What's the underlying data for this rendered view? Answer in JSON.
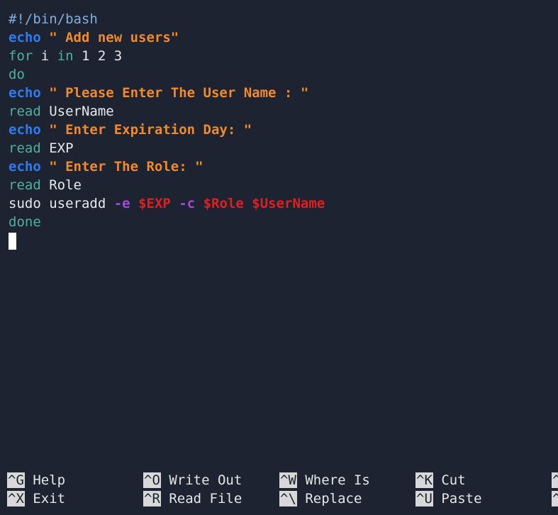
{
  "editor": {
    "lines": [
      [
        {
          "text": "#!/bin/bash",
          "style": "shebang"
        }
      ],
      [
        {
          "text": "echo",
          "style": "kw-bold"
        },
        {
          "text": " \" Add new users\"",
          "style": "str"
        }
      ],
      [
        {
          "text": "for",
          "style": "kw"
        },
        {
          "text": " i ",
          "style": "plain"
        },
        {
          "text": "in",
          "style": "kw"
        },
        {
          "text": " 1 2 3",
          "style": "plain"
        }
      ],
      [
        {
          "text": "do",
          "style": "kw"
        }
      ],
      [
        {
          "text": "echo",
          "style": "kw-bold"
        },
        {
          "text": " \" Please Enter The User Name : \"",
          "style": "str"
        }
      ],
      [
        {
          "text": "read",
          "style": "kw"
        },
        {
          "text": " UserName",
          "style": "plain"
        }
      ],
      [
        {
          "text": "echo",
          "style": "kw-bold"
        },
        {
          "text": " \" Enter Expiration Day: \"",
          "style": "str"
        }
      ],
      [
        {
          "text": "read",
          "style": "kw"
        },
        {
          "text": " EXP",
          "style": "plain"
        }
      ],
      [
        {
          "text": "echo",
          "style": "kw-bold"
        },
        {
          "text": " \" Enter The Role: \"",
          "style": "str"
        }
      ],
      [
        {
          "text": "read",
          "style": "kw"
        },
        {
          "text": " Role",
          "style": "plain"
        }
      ],
      [
        {
          "text": "sudo useradd ",
          "style": "plain"
        },
        {
          "text": "-e",
          "style": "flag"
        },
        {
          "text": " ",
          "style": "plain"
        },
        {
          "text": "$EXP",
          "style": "var"
        },
        {
          "text": " ",
          "style": "plain"
        },
        {
          "text": "-c",
          "style": "flag"
        },
        {
          "text": " ",
          "style": "plain"
        },
        {
          "text": "$Role",
          "style": "var"
        },
        {
          "text": " ",
          "style": "plain"
        },
        {
          "text": "$UserName",
          "style": "var"
        }
      ],
      [
        {
          "text": "done",
          "style": "kw"
        }
      ]
    ]
  },
  "shortcuts": {
    "row1": [
      {
        "key": "^G",
        "label": "Help"
      },
      {
        "key": "^O",
        "label": "Write Out"
      },
      {
        "key": "^W",
        "label": "Where Is"
      },
      {
        "key": "^K",
        "label": "Cut"
      },
      {
        "key": "^",
        "label": ""
      }
    ],
    "row2": [
      {
        "key": "^X",
        "label": "Exit"
      },
      {
        "key": "^R",
        "label": "Read File"
      },
      {
        "key": "^\\",
        "label": "Replace"
      },
      {
        "key": "^U",
        "label": "Paste"
      },
      {
        "key": "^",
        "label": ""
      }
    ]
  },
  "colors": {
    "background": "#1d2331",
    "keyword_bold": "#2f7cf0",
    "string": "#f08a2a",
    "keyword": "#4fb0a0",
    "flag": "#a04ad8",
    "variable": "#e02020",
    "shebang": "#7fb0e0"
  }
}
